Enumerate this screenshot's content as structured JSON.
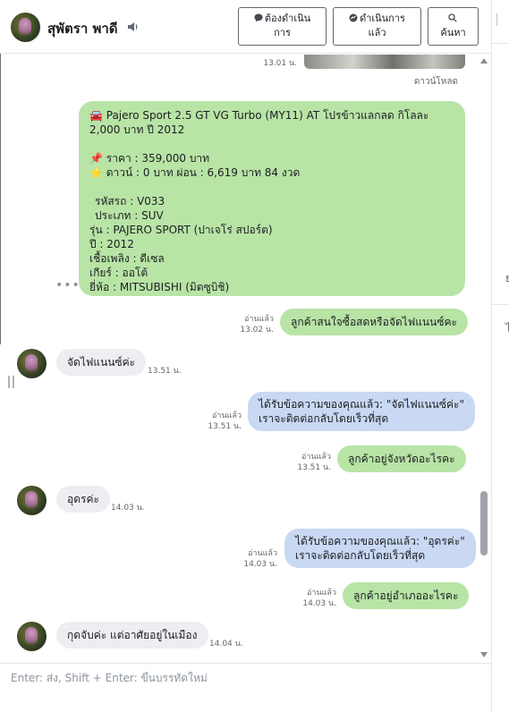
{
  "header": {
    "contact_name": "สุพัตรา พาดี",
    "buttons": {
      "pending": [
        "ต้องดำเนิน",
        "การ"
      ],
      "done": [
        "ดำเนินการ",
        "แล้ว"
      ],
      "search": "ค้นหา"
    }
  },
  "thread": {
    "top_time": "13.01 น.",
    "download_label": "ดาวน์โหลด",
    "product": {
      "title": "🚘 Pajero Sport 2.5 GT VG Turbo (MY11) AT โปรข้าวแลกลด กิโลละ 2,000 บาท ปี 2012",
      "price": "📌 ราคา : 359,000 บาท",
      "down": "⭐ ดาวน์ : 0 บาท ผ่อน : 6,619 บาท 84 งวด",
      "code": "รหัสรถ : V033",
      "type": "ประเภท : SUV",
      "model": "รุ่น : PAJERO SPORT (ปาเจโร่ สปอร์ต)",
      "year": "ปี : 2012",
      "fuel": "เชื้อเพลิง : ดีเซล",
      "gear": "เกียร์ : ออโต้",
      "brand": "ยี่ห้อ : MITSUBISHI (มิตซูบิชิ)"
    },
    "more": "•••",
    "messages": [
      {
        "text": "ลูกค้าสนใจซื้อสดหรือจัดไฟแนนซ์คะ",
        "status": "อ่านแล้ว",
        "time": "13.02 น."
      },
      {
        "text": "จัดไฟแนนซ์ค่ะ",
        "time": "13.51 น."
      },
      {
        "line1": "ได้รับข้อความของคุณแล้ว: \"จัดไฟแนนซ์ค่ะ\"",
        "line2": "เราจะติดต่อกลับโดยเร็วที่สุด",
        "status": "อ่านแล้ว",
        "time": "13.51 น."
      },
      {
        "text": "ลูกค้าอยู่จังหวัดอะไรคะ",
        "status": "อ่านแล้ว",
        "time": "13.51 น."
      },
      {
        "text": "อุดรค่ะ",
        "time": "14.03 น."
      },
      {
        "line1": "ได้รับข้อความของคุณแล้ว: \"อุดรค่ะ\"",
        "line2": "เราจะติดต่อกลับโดยเร็วที่สุด",
        "status": "อ่านแล้ว",
        "time": "14.03 น."
      },
      {
        "text": "ลูกค้าอยู่อำเภออะไรคะ",
        "status": "อ่านแล้ว",
        "time": "14.03 น."
      },
      {
        "text": "กุดจับค่ะ แต่อาศัยอยู่ในเมือง",
        "time": "14.04 น."
      }
    ]
  },
  "composer": {
    "placeholder": "Enter: ส่ง, Shift + Enter: ขึ้นบรรทัดใหม่"
  },
  "colors": {
    "outgoing_bubble": "#b8e4a6",
    "auto_reply_bubble": "#c9d8f3",
    "incoming_bubble": "#eceef1"
  },
  "icons": [
    "speaker-icon",
    "chat-bubble-icon",
    "search-icon",
    "more-icon"
  ]
}
